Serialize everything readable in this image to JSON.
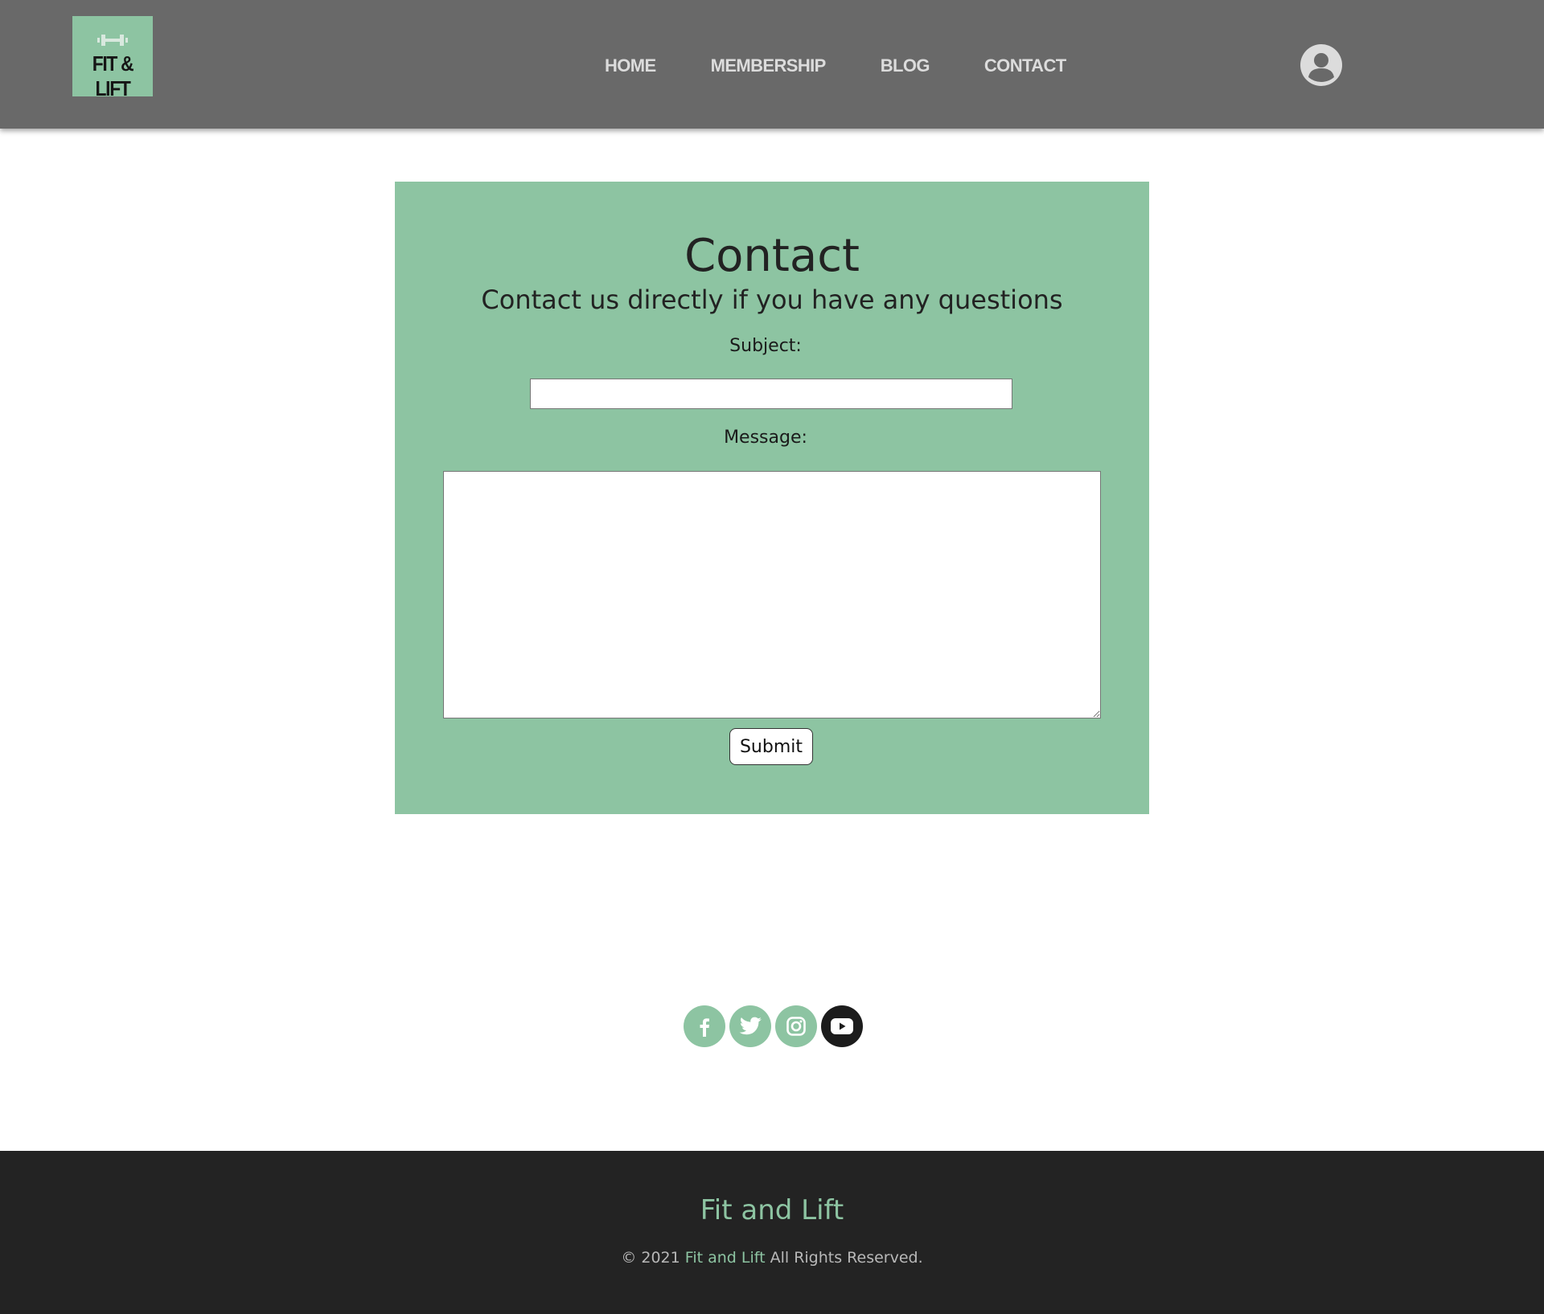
{
  "header": {
    "logo_text": "FIT & LIFT",
    "nav": [
      "HOME",
      "MEMBERSHIP",
      "BLOG",
      "CONTACT"
    ]
  },
  "contact": {
    "title": "Contact",
    "subtitle": "Contact us directly if you have any questions",
    "subject_label": "Subject:",
    "subject_value": "",
    "message_label": "Message:",
    "message_value": "",
    "submit_label": "Submit"
  },
  "social": [
    "facebook-icon",
    "twitter-icon",
    "instagram-icon",
    "youtube-icon"
  ],
  "footer": {
    "brand": "Fit and Lift",
    "copyright_prefix": "© 2021",
    "copyright_brand": "Fit and Lift",
    "copyright_suffix": "All Rights Reserved."
  },
  "colors": {
    "header_bg": "#696969",
    "accent_green": "#8dc4a2",
    "footer_bg": "#232323",
    "nav_text": "#dcdcdc"
  }
}
